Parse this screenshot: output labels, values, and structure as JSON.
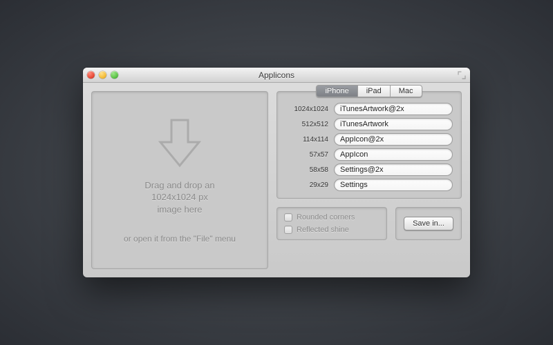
{
  "window": {
    "title": "Applicons"
  },
  "dropzone": {
    "line1": "Drag and drop an",
    "line2": "1024x1024 px",
    "line3": "image here",
    "hint": "or open it from the \"File\" menu"
  },
  "tabs": [
    {
      "label": "iPhone",
      "active": true
    },
    {
      "label": "iPad",
      "active": false
    },
    {
      "label": "Mac",
      "active": false
    }
  ],
  "icon_rows": [
    {
      "dim": "1024x1024",
      "name": "iTunesArtwork@2x"
    },
    {
      "dim": "512x512",
      "name": "iTunesArtwork"
    },
    {
      "dim": "114x114",
      "name": "AppIcon@2x"
    },
    {
      "dim": "57x57",
      "name": "AppIcon"
    },
    {
      "dim": "58x58",
      "name": "Settings@2x"
    },
    {
      "dim": "29x29",
      "name": "Settings"
    }
  ],
  "options": {
    "rounded_label": "Rounded corners",
    "reflected_label": "Reflected shine",
    "rounded_checked": false,
    "reflected_checked": false
  },
  "save_button": "Save in..."
}
